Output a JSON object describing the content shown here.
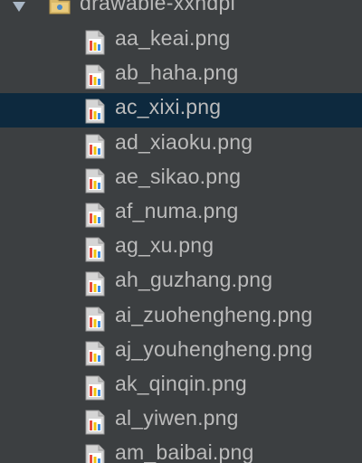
{
  "folder": {
    "name": "drawable-xxhdpi",
    "icon": "folder-icon",
    "expanded": true
  },
  "colors": {
    "background": "#3c3f41",
    "selection": "#0d293e",
    "text": "#bbbbbb"
  },
  "files": [
    {
      "name": "aa_keai.png",
      "icon": "image-file-icon",
      "selected": false
    },
    {
      "name": "ab_haha.png",
      "icon": "image-file-icon",
      "selected": false
    },
    {
      "name": "ac_xixi.png",
      "icon": "image-file-icon",
      "selected": true
    },
    {
      "name": "ad_xiaoku.png",
      "icon": "image-file-icon",
      "selected": false
    },
    {
      "name": "ae_sikao.png",
      "icon": "image-file-icon",
      "selected": false
    },
    {
      "name": "af_numa.png",
      "icon": "image-file-icon",
      "selected": false
    },
    {
      "name": "ag_xu.png",
      "icon": "image-file-icon",
      "selected": false
    },
    {
      "name": "ah_guzhang.png",
      "icon": "image-file-icon",
      "selected": false
    },
    {
      "name": "ai_zuohengheng.png",
      "icon": "image-file-icon",
      "selected": false
    },
    {
      "name": "aj_youhengheng.png",
      "icon": "image-file-icon",
      "selected": false
    },
    {
      "name": "ak_qinqin.png",
      "icon": "image-file-icon",
      "selected": false
    },
    {
      "name": "al_yiwen.png",
      "icon": "image-file-icon",
      "selected": false
    },
    {
      "name": "am_baibai.png",
      "icon": "image-file-icon",
      "selected": false
    }
  ]
}
